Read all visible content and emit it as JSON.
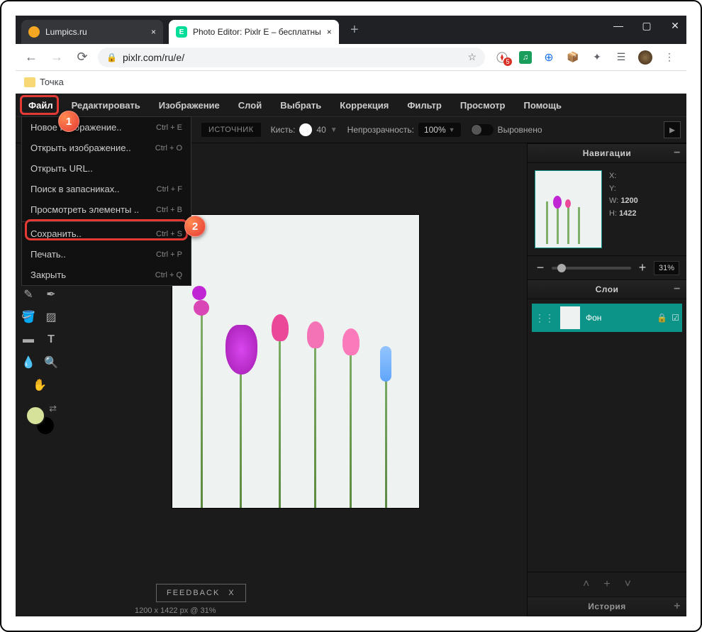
{
  "browser": {
    "tabs": [
      {
        "title": "Lumpics.ru",
        "active": false
      },
      {
        "title": "Photo Editor: Pixlr E – бесплатны",
        "active": true,
        "favicon_letter": "E"
      }
    ],
    "url": "pixlr.com/ru/e/",
    "bookmark": "Точка"
  },
  "menubar": [
    "Файл",
    "Редактировать",
    "Изображение",
    "Слой",
    "Выбрать",
    "Коррекция",
    "Фильтр",
    "Просмотр",
    "Помощь"
  ],
  "dropdown": [
    {
      "label": "Новое изображение..",
      "shortcut": "Ctrl + E"
    },
    {
      "label": "Открыть изображение..",
      "shortcut": "Ctrl + O"
    },
    {
      "label": "Открыть URL.."
    },
    {
      "label": "Поиск в запасниках..",
      "shortcut": "Ctrl + F"
    },
    {
      "label": "Просмотреть элементы ..",
      "shortcut": "Ctrl + B"
    },
    {
      "sep": true
    },
    {
      "label": "Сохранить..",
      "shortcut": "Ctrl + S",
      "highlighted": true
    },
    {
      "label": "Печать..",
      "shortcut": "Ctrl + P"
    },
    {
      "label": "Закрыть",
      "shortcut": "Ctrl + Q"
    }
  ],
  "toolbar": {
    "source": "ИСТОЧНИК",
    "brush_label": "Кисть:",
    "brush_size": "40",
    "opacity_label": "Непрозрачность:",
    "opacity_value": "100%",
    "aligned_label": "Выровнено"
  },
  "nav": {
    "title": "Навигации",
    "x_label": "X:",
    "y_label": "Y:",
    "w_label": "W:",
    "h_label": "H:",
    "w": "1200",
    "h": "1422",
    "zoom": "31%"
  },
  "layers": {
    "title": "Слои",
    "items": [
      {
        "name": "Фон"
      }
    ]
  },
  "history": {
    "title": "История"
  },
  "feedback": {
    "label": "FEEDBACK",
    "close": "X"
  },
  "status": "1200 x 1422 px @ 31%",
  "callouts": {
    "one": "1",
    "two": "2"
  }
}
